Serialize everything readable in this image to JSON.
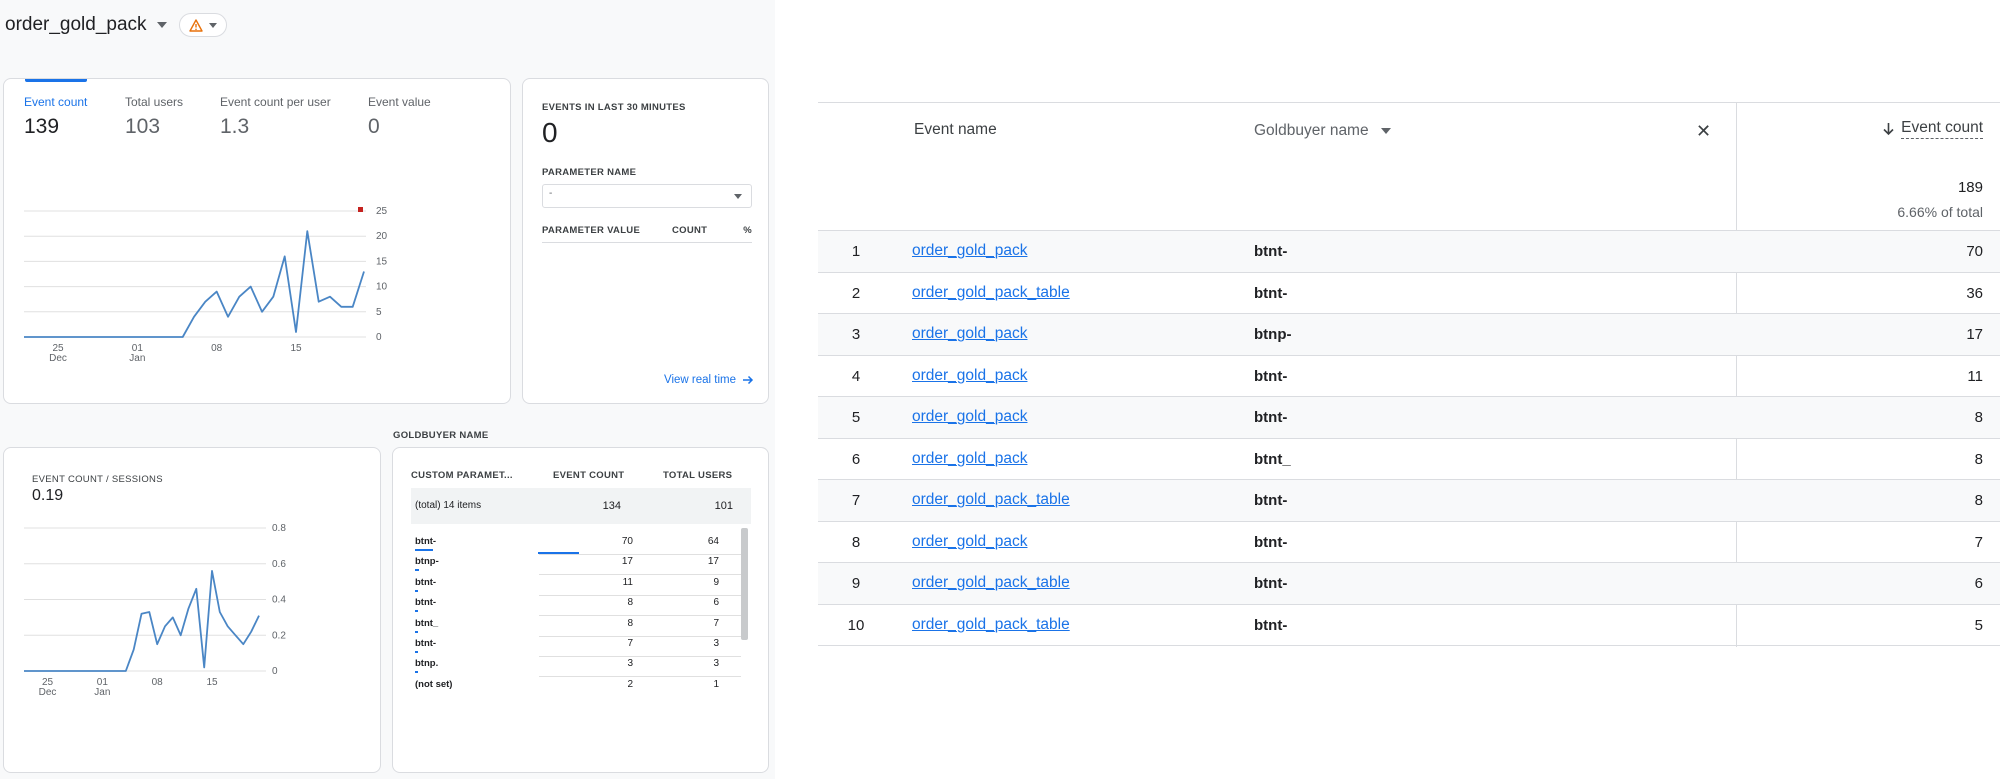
{
  "header": {
    "title": "order_gold_pack"
  },
  "metrics": [
    {
      "label": "Event count",
      "value": "139",
      "active": true
    },
    {
      "label": "Total users",
      "value": "103",
      "active": false
    },
    {
      "label": "Event count per user",
      "value": "1.3",
      "active": false
    },
    {
      "label": "Event value",
      "value": "0",
      "active": false
    }
  ],
  "realtime": {
    "label": "EVENTS IN LAST 30 MINUTES",
    "count": "0",
    "param_label": "PARAMETER NAME",
    "param_value": "-",
    "col_value": "PARAMETER VALUE",
    "col_count": "COUNT",
    "col_pct": "%",
    "link": "View real time"
  },
  "sessions": {
    "label": "EVENT COUNT / SESSIONS",
    "value": "0.19"
  },
  "goldbuyer": {
    "heading": "GOLDBUYER NAME",
    "col_param": "CUSTOM PARAMET...",
    "col_count": "EVENT COUNT",
    "col_users": "TOTAL USERS",
    "total_label": "(total) 14 items",
    "total_count": "134",
    "total_users": "101",
    "rows": [
      {
        "name": "btnt-",
        "count": "70",
        "users": "64"
      },
      {
        "name": "btnp-",
        "count": "17",
        "users": "17"
      },
      {
        "name": "btnt-",
        "count": "11",
        "users": "9"
      },
      {
        "name": "btnt-",
        "count": "8",
        "users": "6"
      },
      {
        "name": "btnt_",
        "count": "8",
        "users": "7"
      },
      {
        "name": "btnt-",
        "count": "7",
        "users": "3"
      },
      {
        "name": "btnp.",
        "count": "3",
        "users": "3"
      },
      {
        "name": "(not set)",
        "count": "2",
        "users": "1"
      }
    ]
  },
  "chart_data": [
    {
      "type": "line",
      "x_ticks": [
        "25\nDec",
        "01\nJan",
        "08",
        "15"
      ],
      "y_ticks": [
        0,
        5,
        10,
        15,
        20,
        25
      ],
      "ylim": [
        0,
        25
      ],
      "values": [
        0,
        0,
        0,
        0,
        0,
        0,
        0,
        0,
        0,
        0,
        0,
        0,
        0,
        0,
        0,
        4,
        7,
        9,
        4,
        8,
        10,
        5,
        8,
        16,
        1,
        21,
        7,
        8,
        6,
        6,
        13
      ]
    },
    {
      "type": "line",
      "x_ticks": [
        "25\nDec",
        "01\nJan",
        "08",
        "15"
      ],
      "y_ticks": [
        0,
        0.2,
        0.4,
        0.6,
        0.8
      ],
      "ylim": [
        0,
        0.8
      ],
      "values": [
        0,
        0,
        0,
        0,
        0,
        0,
        0,
        0,
        0,
        0,
        0,
        0,
        0,
        0,
        0.12,
        0.32,
        0.33,
        0.15,
        0.25,
        0.3,
        0.2,
        0.35,
        0.46,
        0.02,
        0.56,
        0.33,
        0.25,
        0.2,
        0.15,
        0.22,
        0.31
      ]
    }
  ],
  "table": {
    "col_event": "Event name",
    "col_gb": "Goldbuyer name",
    "col_count": "Event count",
    "total": "189",
    "total_pct": "6.66% of total",
    "rows": [
      {
        "idx": "1",
        "event": "order_gold_pack",
        "gb": "btnt-",
        "count": "70"
      },
      {
        "idx": "2",
        "event": "order_gold_pack_table",
        "gb": "btnt-",
        "count": "36"
      },
      {
        "idx": "3",
        "event": "order_gold_pack",
        "gb": "btnp-",
        "count": "17"
      },
      {
        "idx": "4",
        "event": "order_gold_pack",
        "gb": "btnt-",
        "count": "11"
      },
      {
        "idx": "5",
        "event": "order_gold_pack",
        "gb": "btnt-",
        "count": "8"
      },
      {
        "idx": "6",
        "event": "order_gold_pack",
        "gb": "btnt_",
        "count": "8"
      },
      {
        "idx": "7",
        "event": "order_gold_pack_table",
        "gb": "btnt-",
        "count": "8"
      },
      {
        "idx": "8",
        "event": "order_gold_pack",
        "gb": "btnt-",
        "count": "7"
      },
      {
        "idx": "9",
        "event": "order_gold_pack_table",
        "gb": "btnt-",
        "count": "6"
      },
      {
        "idx": "10",
        "event": "order_gold_pack_table",
        "gb": "btnt-",
        "count": "5"
      }
    ]
  }
}
